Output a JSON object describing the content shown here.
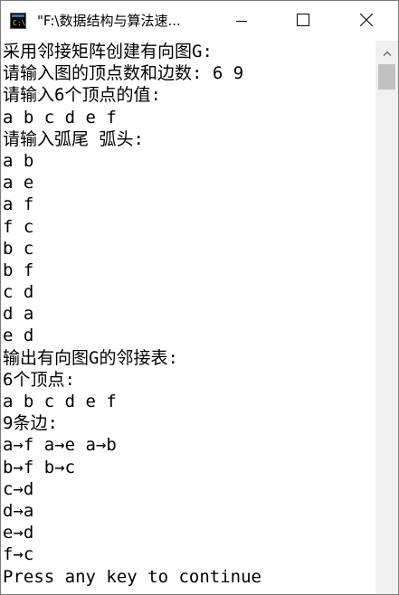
{
  "window": {
    "title": "\"F:\\数据结构与算法速..."
  },
  "icons": {
    "app": "console-app-icon",
    "minimize": "minimize-icon",
    "maximize": "maximize-icon",
    "close": "close-icon",
    "scroll_up": "scroll-up-arrow-icon"
  },
  "console": {
    "lines": [
      "采用邻接矩阵创建有向图G:",
      "请输入图的顶点数和边数: 6 9",
      "请输入6个顶点的值:",
      "a b c d e f",
      "请输入弧尾 弧头:",
      "a b",
      "a e",
      "a f",
      "f c",
      "b c",
      "b f",
      "c d",
      "d a",
      "e d",
      "输出有向图G的邻接表:",
      "6个顶点:",
      "a b c d e f",
      "9条边:",
      "a→f a→e a→b",
      "b→f b→c",
      "c→d",
      "d→a",
      "e→d",
      "f→c",
      "Press any key to continue"
    ]
  }
}
